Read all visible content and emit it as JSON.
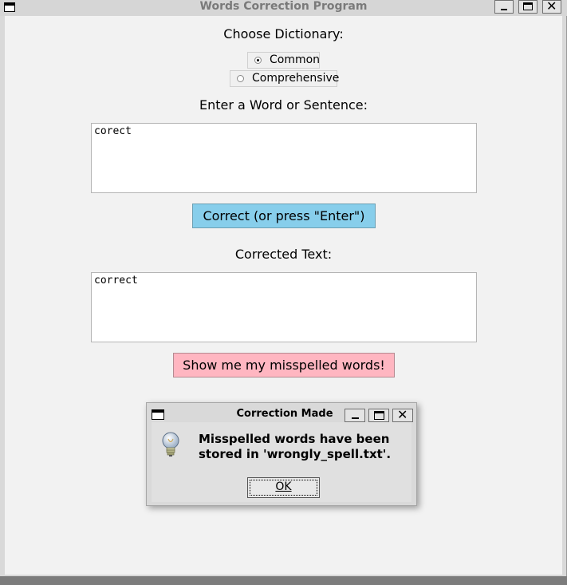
{
  "window": {
    "title": "Words Correction Program"
  },
  "dictionary": {
    "label": "Choose Dictionary:",
    "options": [
      {
        "label": "Common",
        "selected": true
      },
      {
        "label": "Comprehensive",
        "selected": false
      }
    ]
  },
  "input": {
    "label": "Enter a Word or Sentence:",
    "value": "corect"
  },
  "correct_button": {
    "label": "Correct (or press \"Enter\")",
    "color": "#87ceeb"
  },
  "output": {
    "label": "Corrected Text:",
    "value": "correct"
  },
  "misspelled_button": {
    "label": "Show me my misspelled words!",
    "color": "#ffb6c1"
  },
  "dialog": {
    "title": "Correction Made",
    "icon": "lightbulb-icon",
    "message": "Misspelled words have been stored in 'wrongly_spell.txt'.",
    "ok_label": "OK"
  }
}
